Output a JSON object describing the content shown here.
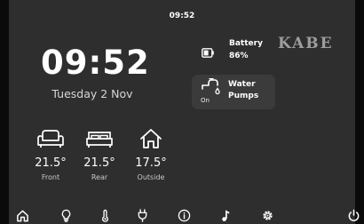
{
  "status_bar": {
    "time": "09:52"
  },
  "clock": {
    "time": "09:52",
    "date": "Tuesday 2 Nov"
  },
  "battery": {
    "label": "Battery",
    "value": "86%",
    "icon": "battery-icon"
  },
  "brand": {
    "logo_text": "KABE"
  },
  "water_pumps": {
    "label_line1": "Water",
    "label_line2": "Pumps",
    "state": "On",
    "icon": "tap-icon"
  },
  "temperatures": [
    {
      "value": "21.5°",
      "label": "Front",
      "icon": "sofa-icon"
    },
    {
      "value": "21.5°",
      "label": "Rear",
      "icon": "bed-icon"
    },
    {
      "value": "17.5°",
      "label": "Outside",
      "icon": "house-icon"
    }
  ],
  "nav": {
    "items": [
      "home-icon",
      "lightbulb-icon",
      "thermometer-icon",
      "power-plug-icon",
      "info-icon",
      "music-icon",
      "settings-icon",
      "power-icon"
    ]
  },
  "colors": {
    "background": "#2e2e2e",
    "card": "#3b3b3b",
    "text": "#ffffff",
    "logo": "#9e9e9e"
  }
}
